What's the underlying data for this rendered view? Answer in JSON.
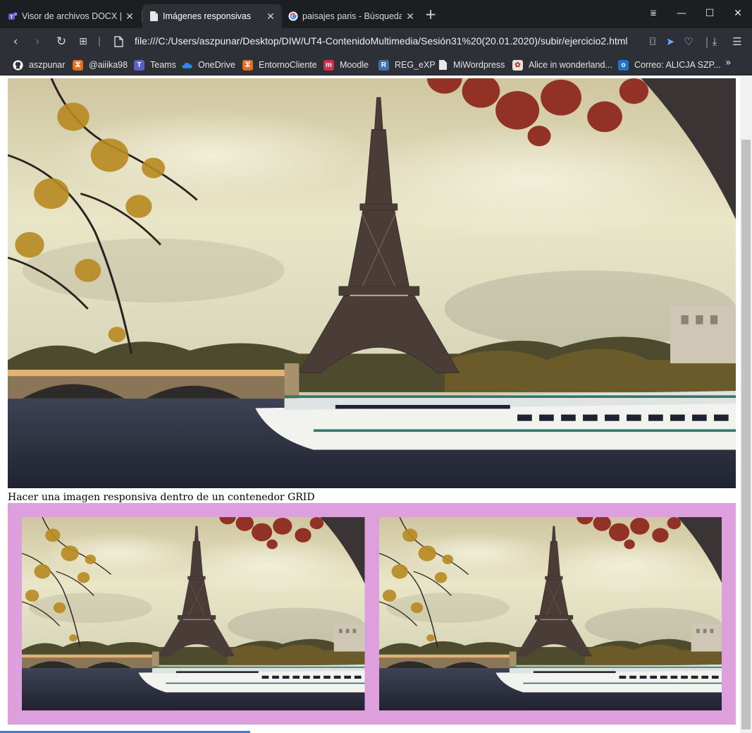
{
  "browser": {
    "tabs": [
      {
        "title": "Visor de archivos DOCX | M",
        "icon": "teams-icon",
        "active": false
      },
      {
        "title": "Imágenes responsivas",
        "icon": "document-icon",
        "active": true
      },
      {
        "title": "paisajes paris - Búsqueda d",
        "icon": "google-icon",
        "active": false
      }
    ],
    "new_tab": "+",
    "url": "file:///C:/Users/aszpunar/Desktop/DIW/UT4-ContenidoMultimedia/Sesión31%20(20.01.2020)/subir/ejercicio2.html",
    "bookmarks": [
      {
        "label": "aszpunar",
        "icon": "github-icon",
        "color": "#2d3036"
      },
      {
        "label": "@aiiika98",
        "icon": "xampp-icon",
        "color": "#e56b1f"
      },
      {
        "label": "Teams",
        "icon": "teams-icon",
        "color": "#5b5fc7"
      },
      {
        "label": "OneDrive",
        "icon": "onedrive-icon",
        "color": "#1f7ae0"
      },
      {
        "label": "EntornoCliente",
        "icon": "xampp-icon",
        "color": "#e56b1f"
      },
      {
        "label": "Moodle",
        "icon": "moodle-icon",
        "color": "#d42e4d"
      },
      {
        "label": "REG_eXP",
        "icon": "regex-icon",
        "color": "#3f6fb3"
      },
      {
        "label": "MiWordpress",
        "icon": "document-icon",
        "color": "#2d3036"
      },
      {
        "label": "Alice in wonderland...",
        "icon": "alice-icon",
        "color": "#e8e3dc"
      },
      {
        "label": "Correo: ALICJA SZP...",
        "icon": "outlook-icon",
        "color": "#1f73c9"
      }
    ]
  },
  "page": {
    "caption": "Hacer una imagen responsiva dentro de un contenedor GRID",
    "grid_background": "#dda0dd",
    "image_description_icon": "eiffel-tower-photo"
  }
}
